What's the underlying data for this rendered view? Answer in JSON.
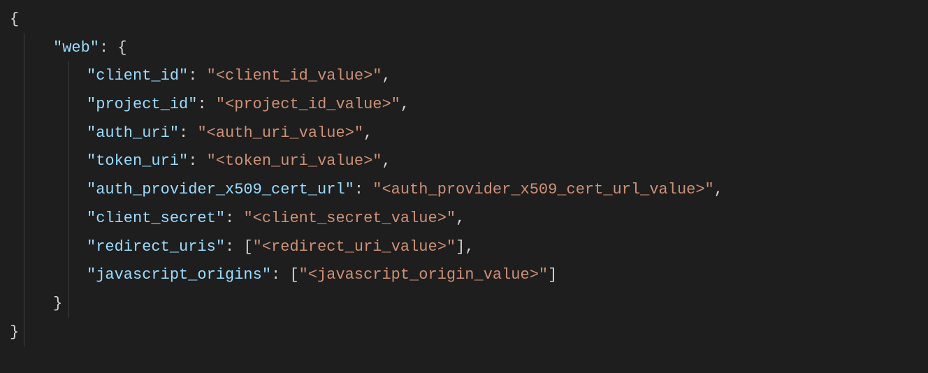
{
  "root_open": "{",
  "root_close": "}",
  "obj_open": "{",
  "obj_close": "}",
  "arr_open": "[",
  "arr_close": "]",
  "colon": ":",
  "comma": ",",
  "quote": "\"",
  "space": " ",
  "web_key": "\"web\"",
  "entries": {
    "client_id": {
      "key": "\"client_id\"",
      "value": "\"<client_id_value>\""
    },
    "project_id": {
      "key": "\"project_id\"",
      "value": "\"<project_id_value>\""
    },
    "auth_uri": {
      "key": "\"auth_uri\"",
      "value": "\"<auth_uri_value>\""
    },
    "token_uri": {
      "key": "\"token_uri\"",
      "value": "\"<token_uri_value>\""
    },
    "auth_provider_x509_cert_url": {
      "key": "\"auth_provider_x509_cert_url\"",
      "value": "\"<auth_provider_x509_cert_url_value>\""
    },
    "client_secret": {
      "key": "\"client_secret\"",
      "value": "\"<client_secret_value>\""
    },
    "redirect_uris": {
      "key": "\"redirect_uris\"",
      "value": "\"<redirect_uri_value>\""
    },
    "javascript_origins": {
      "key": "\"javascript_origins\"",
      "value": "\"<javascript_origin_value>\""
    }
  }
}
